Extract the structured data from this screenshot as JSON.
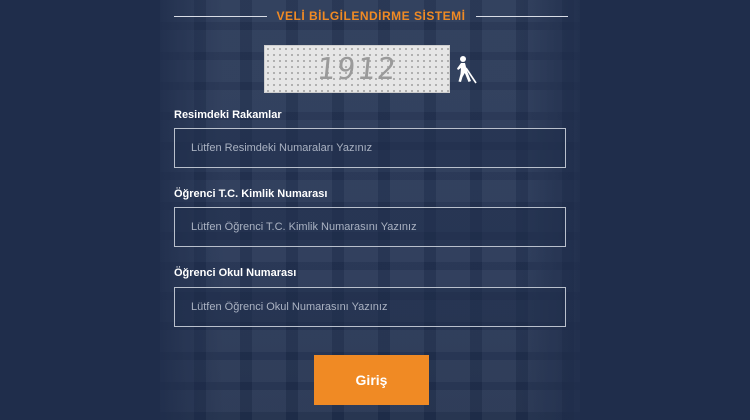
{
  "header": {
    "title": "VELİ BİLGİLENDİRME SİSTEMİ"
  },
  "captcha": {
    "text": "1912",
    "audio_icon": "accessibility-icon"
  },
  "form": {
    "fields": [
      {
        "label": "Resimdeki Rakamlar",
        "placeholder": "Lütfen Resimdeki Numaraları Yazınız",
        "value": ""
      },
      {
        "label": "Öğrenci T.C. Kimlik Numarası",
        "placeholder": "Lütfen Öğrenci T.C. Kimlik Numarasını Yazınız",
        "value": ""
      },
      {
        "label": "Öğrenci Okul Numarası",
        "placeholder": "Lütfen Öğrenci Okul Numarasını Yazınız",
        "value": ""
      }
    ],
    "submit_label": "Giriş"
  },
  "colors": {
    "accent": "#f08a24",
    "background": "#1f2d4b"
  }
}
